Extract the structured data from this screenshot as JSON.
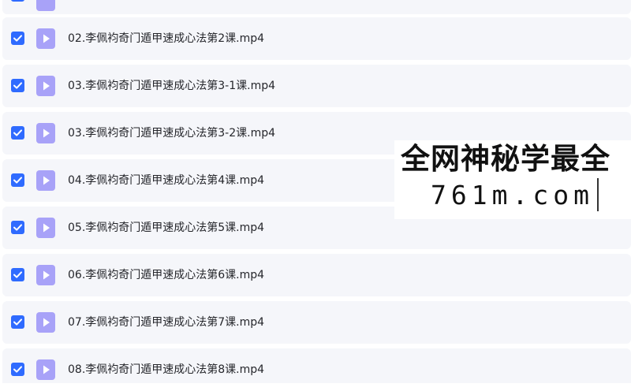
{
  "files": [
    {
      "name": "",
      "checked": true
    },
    {
      "name": "02.李佩袀奇门遁甲速成心法第2课.mp4",
      "checked": true
    },
    {
      "name": "03.李佩袀奇门遁甲速成心法第3-1课.mp4",
      "checked": true
    },
    {
      "name": "03.李佩袀奇门遁甲速成心法第3-2课.mp4",
      "checked": true
    },
    {
      "name": "04.李佩袀奇门遁甲速成心法第4课.mp4",
      "checked": true
    },
    {
      "name": "05.李佩袀奇门遁甲速成心法第5课.mp4",
      "checked": true
    },
    {
      "name": "06.李佩袀奇门遁甲速成心法第6课.mp4",
      "checked": true
    },
    {
      "name": "07.李佩袀奇门遁甲速成心法第7课.mp4",
      "checked": true
    },
    {
      "name": "08.李佩袀奇门遁甲速成心法第8课.mp4",
      "checked": true
    }
  ],
  "watermark": {
    "line1": "全网神秘学最全",
    "line2": "761m.com"
  },
  "colors": {
    "checkbox": "#2f6bff",
    "file_icon": "#a8a2f8",
    "row_background": "#f5f6fa"
  },
  "icons": {
    "checkbox": "checkmark-icon",
    "file": "video-file-icon"
  }
}
